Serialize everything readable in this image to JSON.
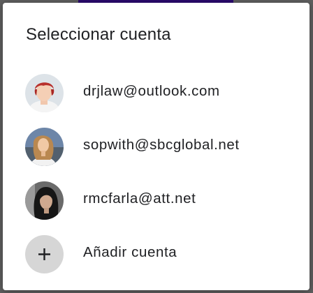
{
  "dialog": {
    "title": "Seleccionar cuenta",
    "accounts": [
      {
        "email": "drjlaw@outlook.com",
        "avatar": "user-avatar-1"
      },
      {
        "email": "sopwith@sbcglobal.net",
        "avatar": "user-avatar-2"
      },
      {
        "email": "rmcfarla@att.net",
        "avatar": "user-avatar-3"
      }
    ],
    "add_account_label": "Añadir cuenta",
    "add_icon": "plus-icon"
  },
  "colors": {
    "scrim": "#5f5f5f",
    "surface": "#ffffff",
    "text": "#202124",
    "add_icon_bg": "#d6d6d6",
    "top_accent": "#2a0a6e"
  }
}
